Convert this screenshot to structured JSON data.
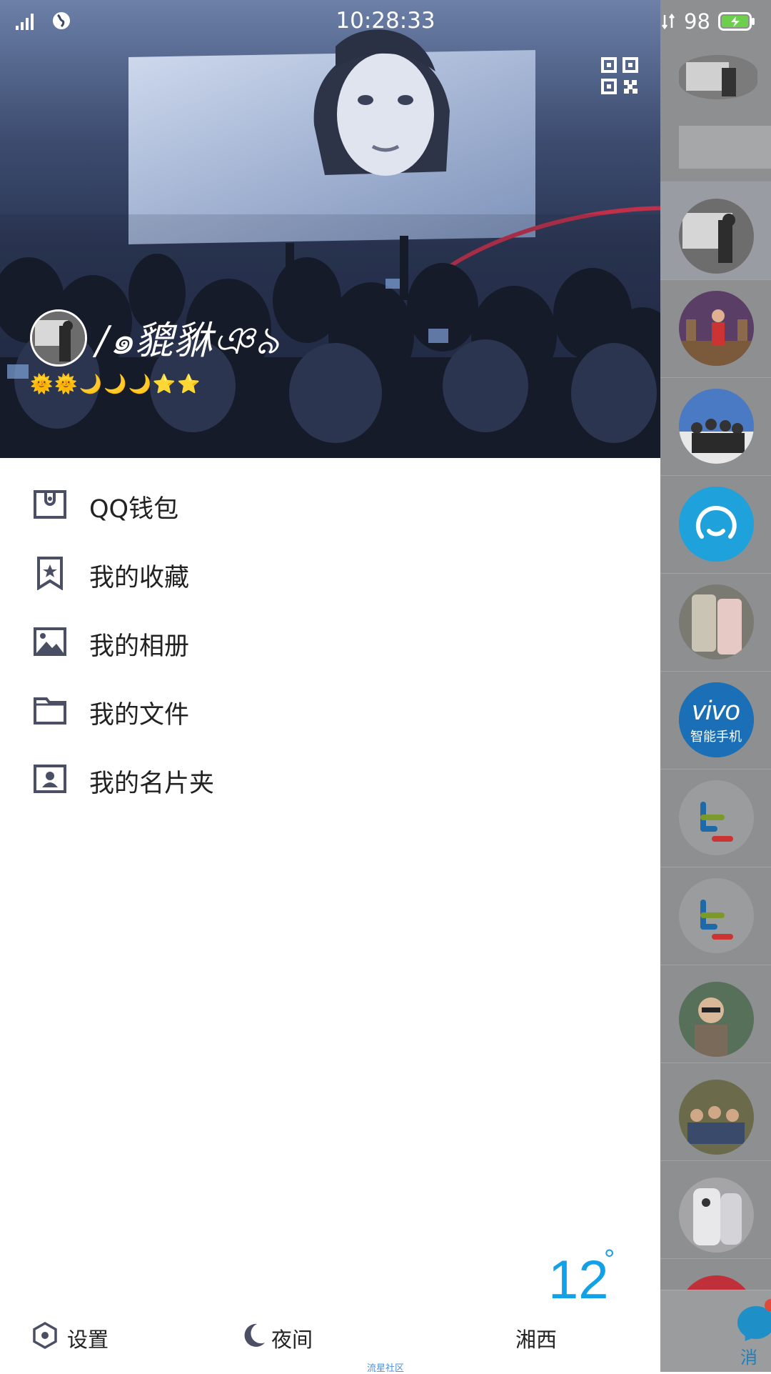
{
  "status_bar": {
    "time": "10:28:33",
    "battery_percent": "98",
    "signal_icon": "signal-icon",
    "globe_icon": "globe-icon",
    "battery_icon": "battery-charging-icon"
  },
  "profile": {
    "nickname": "/๑貔貅ঞ৯",
    "level_icons": "🌞🌞🌙🌙🌙⭐⭐",
    "qr_icon": "qr-code-icon"
  },
  "menu": {
    "items": [
      {
        "label": "QQ钱包",
        "icon": "wallet-icon"
      },
      {
        "label": "我的收藏",
        "icon": "bookmark-star-icon"
      },
      {
        "label": "我的相册",
        "icon": "photo-album-icon"
      },
      {
        "label": "我的文件",
        "icon": "folder-icon"
      },
      {
        "label": "我的名片夹",
        "icon": "contact-card-icon"
      }
    ]
  },
  "weather": {
    "temperature": "12",
    "degree_symbol": "°",
    "city": "湘西"
  },
  "bottom": {
    "settings_label": "设置",
    "night_label": "夜间",
    "footer": "流星社区"
  },
  "right_panel": {
    "tab_label": "消息"
  },
  "colors": {
    "accent_blue": "#12a1e6",
    "icon_gray": "#4a4f63",
    "text": "#222222"
  }
}
